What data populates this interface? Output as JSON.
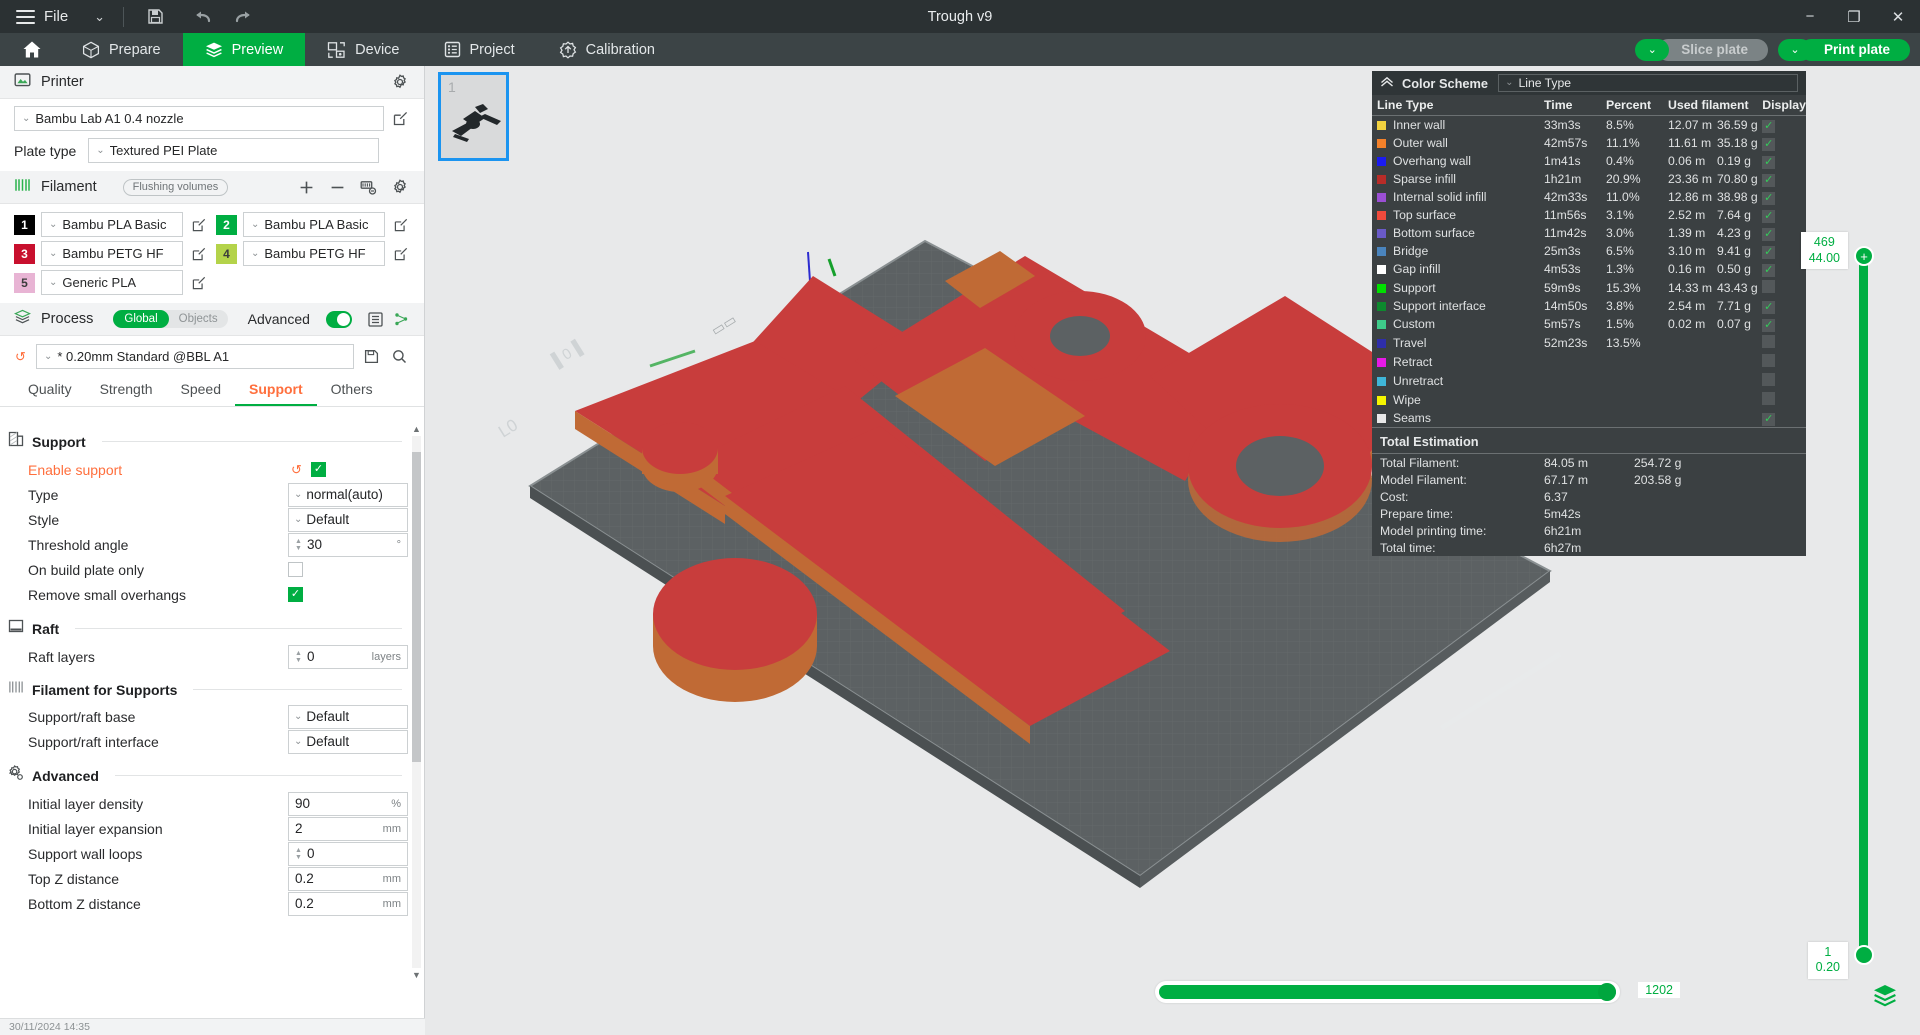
{
  "window": {
    "title": "Trough v9",
    "minimize": "−",
    "maximize": "❐",
    "close": "✕"
  },
  "menubar": {
    "file_label": "File",
    "dropdown_chevron": "⌄",
    "save_icon": "save-icon",
    "undo_icon": "undo-icon",
    "redo_icon": "redo-icon"
  },
  "nav": {
    "home_icon": "home-icon",
    "tabs": [
      {
        "label": "Prepare",
        "icon": "cube-icon",
        "active": false
      },
      {
        "label": "Preview",
        "icon": "layers-icon",
        "active": true
      },
      {
        "label": "Device",
        "icon": "device-icon",
        "active": false
      },
      {
        "label": "Project",
        "icon": "list-icon",
        "active": false
      },
      {
        "label": "Calibration",
        "icon": "target-icon",
        "active": false
      }
    ],
    "slice_plate_label": "Slice plate",
    "print_plate_label": "Print plate",
    "chevron": "⌄"
  },
  "printer": {
    "section_label": "Printer",
    "gear_icon": "gear-icon",
    "profile": "Bambu Lab A1 0.4 nozzle",
    "plate_type_label": "Plate type",
    "plate_type": "Textured PEI Plate",
    "edit_icon": "edit-icon"
  },
  "filament": {
    "section_label": "Filament",
    "flushing_volumes_label": "Flushing volumes",
    "add_icon": "plus-icon",
    "remove_icon": "minus-icon",
    "ams_icon": "ams-icon",
    "gear_icon": "gear-icon",
    "slots": [
      {
        "num": "1",
        "name": "Bambu PLA Basic",
        "color": "#000000",
        "text_color": "#ffffff"
      },
      {
        "num": "2",
        "name": "Bambu PLA Basic",
        "color": "#00ae42",
        "text_color": "#ffffff"
      },
      {
        "num": "3",
        "name": "Bambu PETG HF",
        "color": "#c8102e",
        "text_color": "#ffffff"
      },
      {
        "num": "4",
        "name": "Bambu PETG HF",
        "color": "#b4d34a",
        "text_color": "#3c3c3c"
      },
      {
        "num": "5",
        "name": "Generic PLA",
        "color": "#e8b4d4",
        "text_color": "#3c3c3c"
      }
    ]
  },
  "process": {
    "section_label": "Process",
    "mode_global": "Global",
    "mode_objects": "Objects",
    "advanced_label": "Advanced",
    "advanced_on": true,
    "preset": "* 0.20mm Standard @BBL A1",
    "reset_icon": "reset-icon",
    "save_icon": "save-icon",
    "search_icon": "search-icon",
    "compare_icon": "compare-icon",
    "list_icon": "list-icon",
    "tabs": [
      {
        "label": "Quality",
        "active": false
      },
      {
        "label": "Strength",
        "active": false
      },
      {
        "label": "Speed",
        "active": false
      },
      {
        "label": "Support",
        "active": true
      },
      {
        "label": "Others",
        "active": false
      }
    ]
  },
  "support_settings": {
    "groups": [
      {
        "title": "Support",
        "icon": "support-icon",
        "rows": [
          {
            "name": "Enable support",
            "type": "checkbox",
            "value": true,
            "highlight": true,
            "has_reset": true
          },
          {
            "name": "Type",
            "type": "select",
            "value": "normal(auto)"
          },
          {
            "name": "Style",
            "type": "select",
            "value": "Default"
          },
          {
            "name": "Threshold angle",
            "type": "spinner",
            "value": "30",
            "unit": "°"
          },
          {
            "name": "On build plate only",
            "type": "checkbox",
            "value": false
          },
          {
            "name": "Remove small overhangs",
            "type": "checkbox",
            "value": true
          }
        ]
      },
      {
        "title": "Raft",
        "icon": "raft-icon",
        "rows": [
          {
            "name": "Raft layers",
            "type": "spinner",
            "value": "0",
            "unit": "layers"
          }
        ]
      },
      {
        "title": "Filament for Supports",
        "icon": "filament-icon",
        "rows": [
          {
            "name": "Support/raft base",
            "type": "select",
            "value": "Default"
          },
          {
            "name": "Support/raft interface",
            "type": "select",
            "value": "Default"
          }
        ]
      },
      {
        "title": "Advanced",
        "icon": "advanced-icon",
        "rows": [
          {
            "name": "Initial layer density",
            "type": "text",
            "value": "90",
            "unit": "%"
          },
          {
            "name": "Initial layer expansion",
            "type": "text",
            "value": "2",
            "unit": "mm"
          },
          {
            "name": "Support wall loops",
            "type": "spinner",
            "value": "0",
            "unit": ""
          },
          {
            "name": "Top Z distance",
            "type": "text",
            "value": "0.2",
            "unit": "mm"
          },
          {
            "name": "Bottom Z distance",
            "type": "text",
            "value": "0.2",
            "unit": "mm"
          }
        ]
      }
    ]
  },
  "statusbar": {
    "text": "30/11/2024 14:35"
  },
  "plate_thumbnails": [
    {
      "number": "1",
      "selected": true
    }
  ],
  "legend": {
    "title": "Color Scheme",
    "collapse_icon": "chevron-up-icon",
    "scheme_value": "Line Type",
    "columns": [
      "Line Type",
      "Time",
      "Percent",
      "Used filament",
      "Display"
    ],
    "rows": [
      {
        "name": "Inner wall",
        "color": "#f2d23f",
        "time": "33m3s",
        "percent": "8.5%",
        "length": "12.07 m",
        "weight": "36.59 g",
        "display": true
      },
      {
        "name": "Outer wall",
        "color": "#f4812a",
        "time": "42m57s",
        "percent": "11.1%",
        "length": "11.61 m",
        "weight": "35.18 g",
        "display": true
      },
      {
        "name": "Overhang wall",
        "color": "#1b1bf0",
        "time": "1m41s",
        "percent": "0.4%",
        "length": "0.06 m",
        "weight": "0.19 g",
        "display": true
      },
      {
        "name": "Sparse infill",
        "color": "#b82c28",
        "time": "1h21m",
        "percent": "20.9%",
        "length": "23.36 m",
        "weight": "70.80 g",
        "display": true
      },
      {
        "name": "Internal solid infill",
        "color": "#9b4fd4",
        "time": "42m33s",
        "percent": "11.0%",
        "length": "12.86 m",
        "weight": "38.98 g",
        "display": true
      },
      {
        "name": "Top surface",
        "color": "#f04a3c",
        "time": "11m56s",
        "percent": "3.1%",
        "length": "2.52 m",
        "weight": "7.64 g",
        "display": true
      },
      {
        "name": "Bottom surface",
        "color": "#6a5ac8",
        "time": "11m42s",
        "percent": "3.0%",
        "length": "1.39 m",
        "weight": "4.23 g",
        "display": true
      },
      {
        "name": "Bridge",
        "color": "#4a84bd",
        "time": "25m3s",
        "percent": "6.5%",
        "length": "3.10 m",
        "weight": "9.41 g",
        "display": true
      },
      {
        "name": "Gap infill",
        "color": "#ffffff",
        "time": "4m53s",
        "percent": "1.3%",
        "length": "0.16 m",
        "weight": "0.50 g",
        "display": true
      },
      {
        "name": "Support",
        "color": "#00e000",
        "time": "59m9s",
        "percent": "15.3%",
        "length": "14.33 m",
        "weight": "43.43 g",
        "display": false
      },
      {
        "name": "Support interface",
        "color": "#0d8a2e",
        "time": "14m50s",
        "percent": "3.8%",
        "length": "2.54 m",
        "weight": "7.71 g",
        "display": true
      },
      {
        "name": "Custom",
        "color": "#3ecb8a",
        "time": "5m57s",
        "percent": "1.5%",
        "length": "0.02 m",
        "weight": "0.07 g",
        "display": true
      },
      {
        "name": "Travel",
        "color": "#2e2eaa",
        "time": "52m23s",
        "percent": "13.5%",
        "length": "",
        "weight": "",
        "display": false
      },
      {
        "name": "Retract",
        "color": "#e619e6",
        "time": "",
        "percent": "",
        "length": "",
        "weight": "",
        "display": false
      },
      {
        "name": "Unretract",
        "color": "#3fb6d8",
        "time": "",
        "percent": "",
        "length": "",
        "weight": "",
        "display": false
      },
      {
        "name": "Wipe",
        "color": "#f5f500",
        "time": "",
        "percent": "",
        "length": "",
        "weight": "",
        "display": false
      },
      {
        "name": "Seams",
        "color": "#e8e8e8",
        "time": "",
        "percent": "",
        "length": "",
        "weight": "",
        "display": true
      }
    ],
    "total_title": "Total Estimation",
    "totals": [
      {
        "label": "Total Filament:",
        "v1": "84.05 m",
        "v2": "254.72 g"
      },
      {
        "label": "Model Filament:",
        "v1": "67.17 m",
        "v2": "203.58 g"
      },
      {
        "label": "Cost:",
        "v1": "6.37",
        "v2": ""
      },
      {
        "label": "Prepare time:",
        "v1": "5m42s",
        "v2": ""
      },
      {
        "label": "Model printing time:",
        "v1": "6h21m",
        "v2": ""
      },
      {
        "label": "Total time:",
        "v1": "6h27m",
        "v2": ""
      }
    ]
  },
  "layer_slider": {
    "top_layer": "469",
    "top_height": "44.00",
    "bottom_layer": "1",
    "bottom_height": "0.20",
    "plus_glyph": "+"
  },
  "moves_slider": {
    "value": "1202",
    "percent": 100
  },
  "view_tools": {
    "layers_icon": "layers-stack-icon"
  },
  "colors": {
    "accent_green": "#00ae42",
    "orange": "#ff6f3d",
    "dark_chrome": "#2b3133",
    "nav_chrome": "#3c4446",
    "panel_dark": "#3b4042"
  }
}
